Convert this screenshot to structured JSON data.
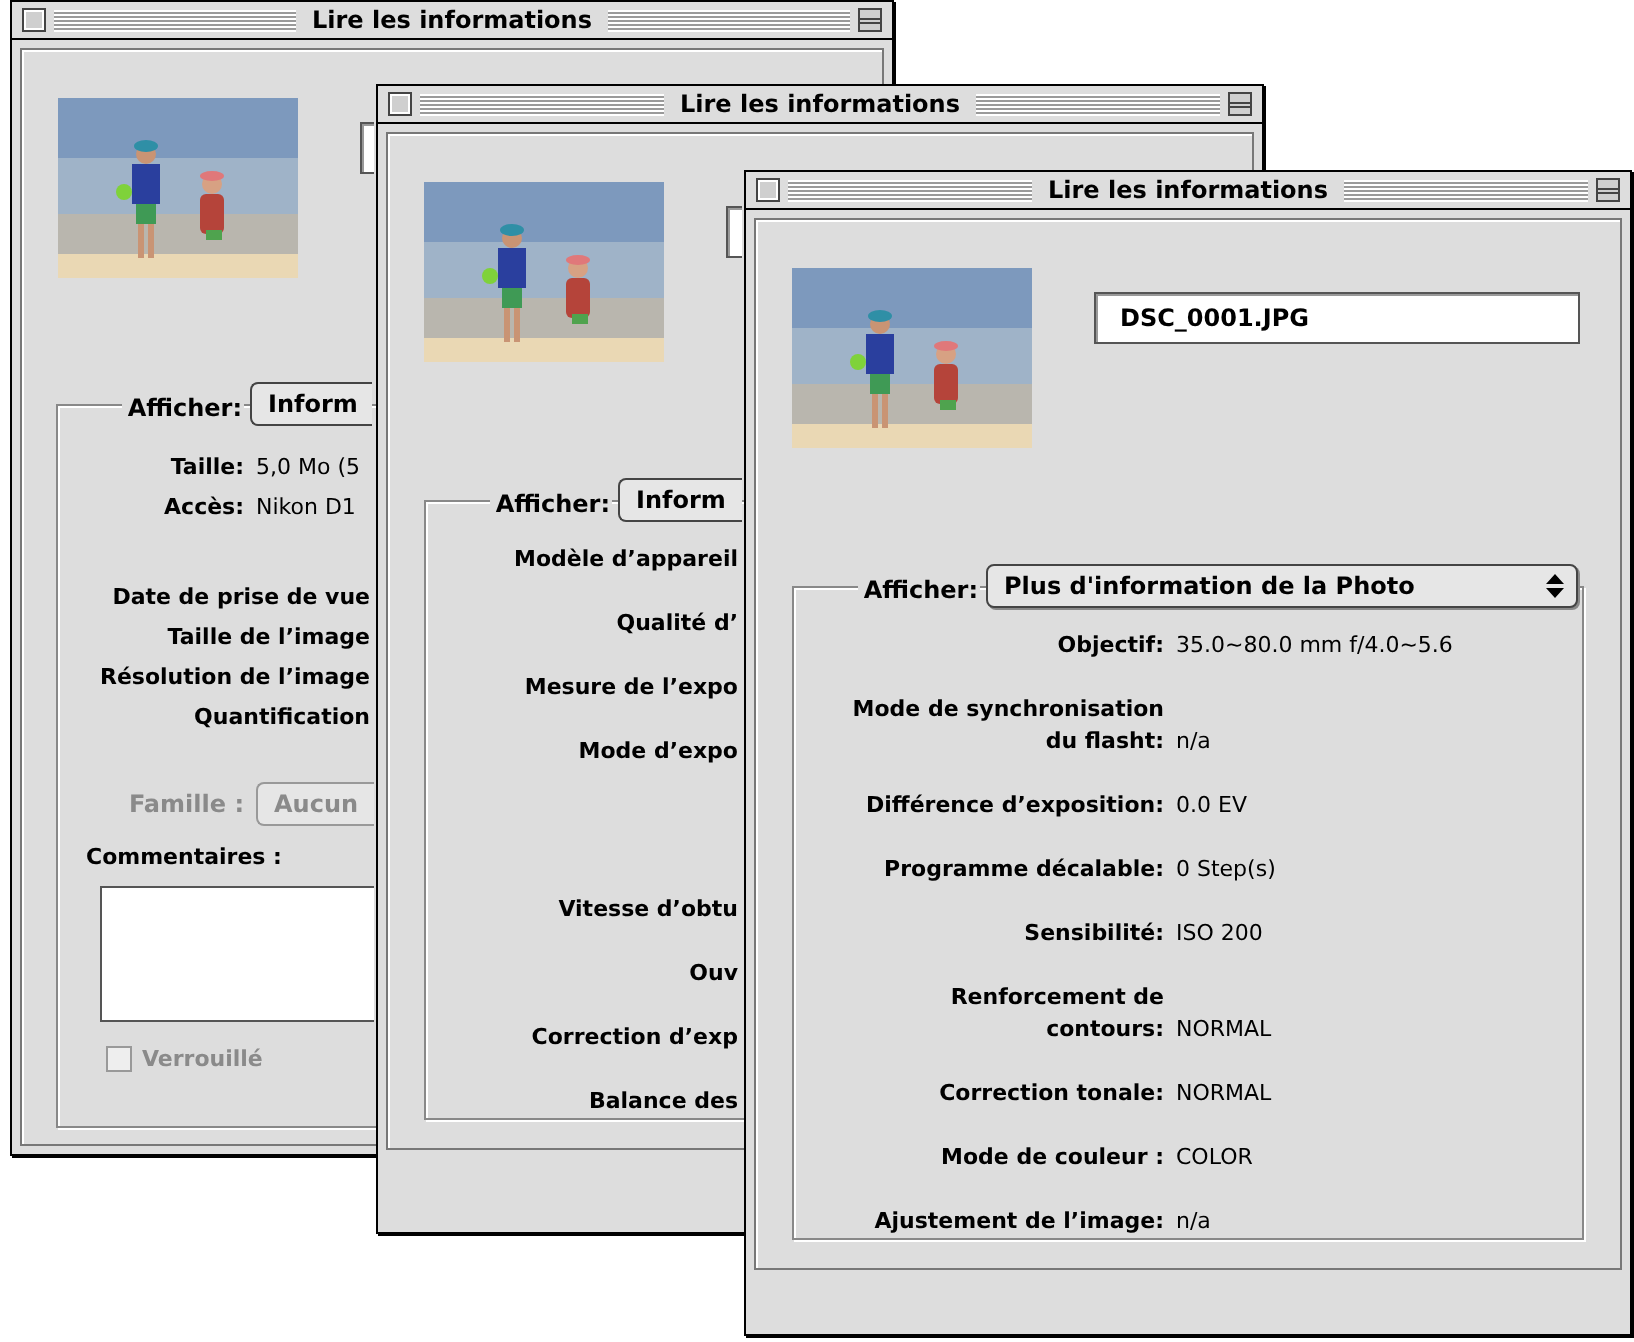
{
  "windows": [
    {
      "title": "Lire les informations",
      "kind": "general",
      "display_label": "Afficher:",
      "display_value": "Inform",
      "sections": [
        [
          {
            "label": "Taille:",
            "value": "5,0 Mo (5"
          },
          {
            "label": "Accès:",
            "value": "Nikon D1"
          }
        ],
        [
          {
            "label": "Date de prise de vue"
          },
          {
            "label": "Taille de l’image"
          },
          {
            "label": "Résolution de l’image"
          },
          {
            "label": "Quantification"
          }
        ]
      ],
      "family": {
        "label": "Famille :",
        "value": "Aucun",
        "disabled": true
      },
      "comments_label": "Commentaires :",
      "locked": {
        "label": "Verrouillé",
        "checked": false,
        "disabled": true
      }
    },
    {
      "title": "Lire les informations",
      "display_label": "Afficher:",
      "display_value": "Inform",
      "sections": [
        [
          {
            "label": "Modèle d’appareil"
          },
          {
            "label": "Qualité d’"
          },
          {
            "label": "Mesure de l’expo"
          },
          {
            "label": "Mode d’expo"
          }
        ],
        [
          {
            "label": "Vitesse d’obtu"
          },
          {
            "label": "Ouv"
          },
          {
            "label": "Correction d’exp"
          },
          {
            "label": "Balance des"
          }
        ]
      ]
    },
    {
      "title": "Lire les informations",
      "filename": "DSC_0001.JPG",
      "display_label": "Afficher:",
      "display_value": "Plus d'information de la Photo",
      "sections": [
        [
          {
            "label": "Objectif:",
            "value": "35.0~80.0 mm f/4.0~5.6"
          },
          {
            "label": "Mode de synchronisation\ndu flasht:",
            "value": "n/a"
          },
          {
            "label": "Différence d’exposition:",
            "value": "0.0 EV"
          },
          {
            "label": "Programme décalable:",
            "value": "0 Step(s)"
          },
          {
            "label": "Sensibilité:",
            "value": "ISO 200"
          },
          {
            "label": "Renforcement de\ncontours:",
            "value": "NORMAL"
          },
          {
            "label": "Correction tonale:",
            "value": "NORMAL"
          },
          {
            "label": "Mode de couleur :",
            "value": "COLOR"
          },
          {
            "label": "Ajustement de l’image:",
            "value": "n/a"
          }
        ]
      ]
    }
  ]
}
